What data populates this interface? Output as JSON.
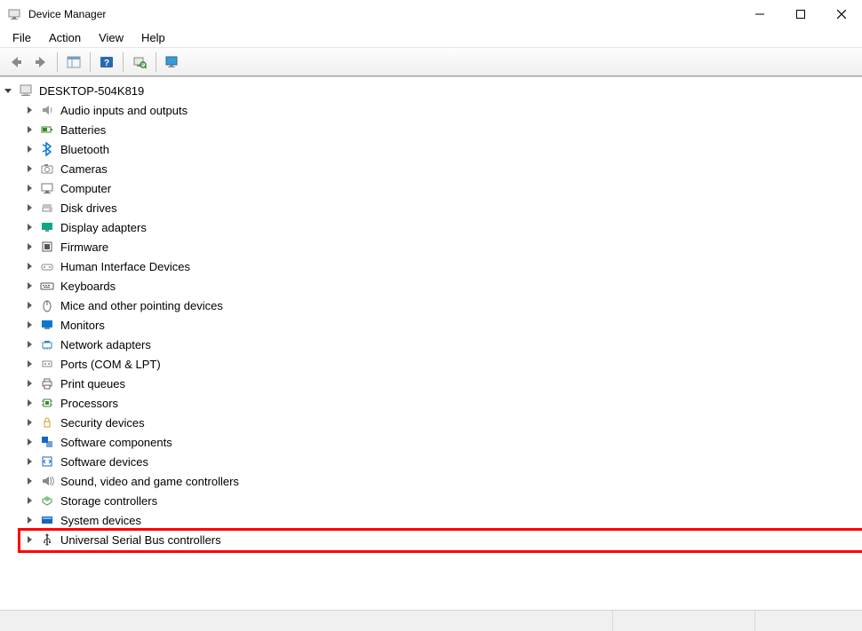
{
  "window": {
    "title": "Device Manager"
  },
  "menu": {
    "items": [
      "File",
      "Action",
      "View",
      "Help"
    ]
  },
  "toolbar": {
    "buttons": [
      {
        "name": "nav-back-button",
        "icon": "arrow-left-icon"
      },
      {
        "name": "nav-forward-button",
        "icon": "arrow-right-icon"
      },
      {
        "sep": true
      },
      {
        "name": "show-hide-tree-button",
        "icon": "tree-pane-icon"
      },
      {
        "sep": true
      },
      {
        "name": "help-button",
        "icon": "help-icon"
      },
      {
        "sep": true
      },
      {
        "name": "scan-hardware-button",
        "icon": "scan-hw-icon"
      },
      {
        "sep": true
      },
      {
        "name": "monitor-button",
        "icon": "monitor-icon"
      }
    ]
  },
  "tree": {
    "root": {
      "label": "DESKTOP-504K819",
      "icon": "computer-root-icon",
      "expanded": true
    },
    "categories": [
      {
        "label": "Audio inputs and outputs",
        "icon": "audio-icon",
        "cls": "ic-audio"
      },
      {
        "label": "Batteries",
        "icon": "battery-icon",
        "cls": "ic-batteries"
      },
      {
        "label": "Bluetooth",
        "icon": "bluetooth-icon",
        "cls": "ic-bluetooth"
      },
      {
        "label": "Cameras",
        "icon": "camera-icon",
        "cls": "ic-cameras"
      },
      {
        "label": "Computer",
        "icon": "computer-icon",
        "cls": "ic-computer"
      },
      {
        "label": "Disk drives",
        "icon": "disk-icon",
        "cls": "ic-disk"
      },
      {
        "label": "Display adapters",
        "icon": "display-icon",
        "cls": "ic-display"
      },
      {
        "label": "Firmware",
        "icon": "firmware-icon",
        "cls": "ic-firmware"
      },
      {
        "label": "Human Interface Devices",
        "icon": "hid-icon",
        "cls": "ic-hid"
      },
      {
        "label": "Keyboards",
        "icon": "keyboard-icon",
        "cls": "ic-keyboards"
      },
      {
        "label": "Mice and other pointing devices",
        "icon": "mouse-icon",
        "cls": "ic-mice"
      },
      {
        "label": "Monitors",
        "icon": "monitor-icon",
        "cls": "ic-monitors"
      },
      {
        "label": "Network adapters",
        "icon": "network-icon",
        "cls": "ic-network"
      },
      {
        "label": "Ports (COM & LPT)",
        "icon": "port-icon",
        "cls": "ic-ports"
      },
      {
        "label": "Print queues",
        "icon": "printer-icon",
        "cls": "ic-print"
      },
      {
        "label": "Processors",
        "icon": "cpu-icon",
        "cls": "ic-processors"
      },
      {
        "label": "Security devices",
        "icon": "security-icon",
        "cls": "ic-security"
      },
      {
        "label": "Software components",
        "icon": "sw-comp-icon",
        "cls": "ic-swcomp"
      },
      {
        "label": "Software devices",
        "icon": "sw-dev-icon",
        "cls": "ic-swdev"
      },
      {
        "label": "Sound, video and game controllers",
        "icon": "sound-icon",
        "cls": "ic-sound"
      },
      {
        "label": "Storage controllers",
        "icon": "storage-icon",
        "cls": "ic-storage"
      },
      {
        "label": "System devices",
        "icon": "system-icon",
        "cls": "ic-system"
      },
      {
        "label": "Universal Serial Bus controllers",
        "icon": "usb-icon",
        "cls": "ic-usb",
        "highlighted": true
      }
    ]
  }
}
